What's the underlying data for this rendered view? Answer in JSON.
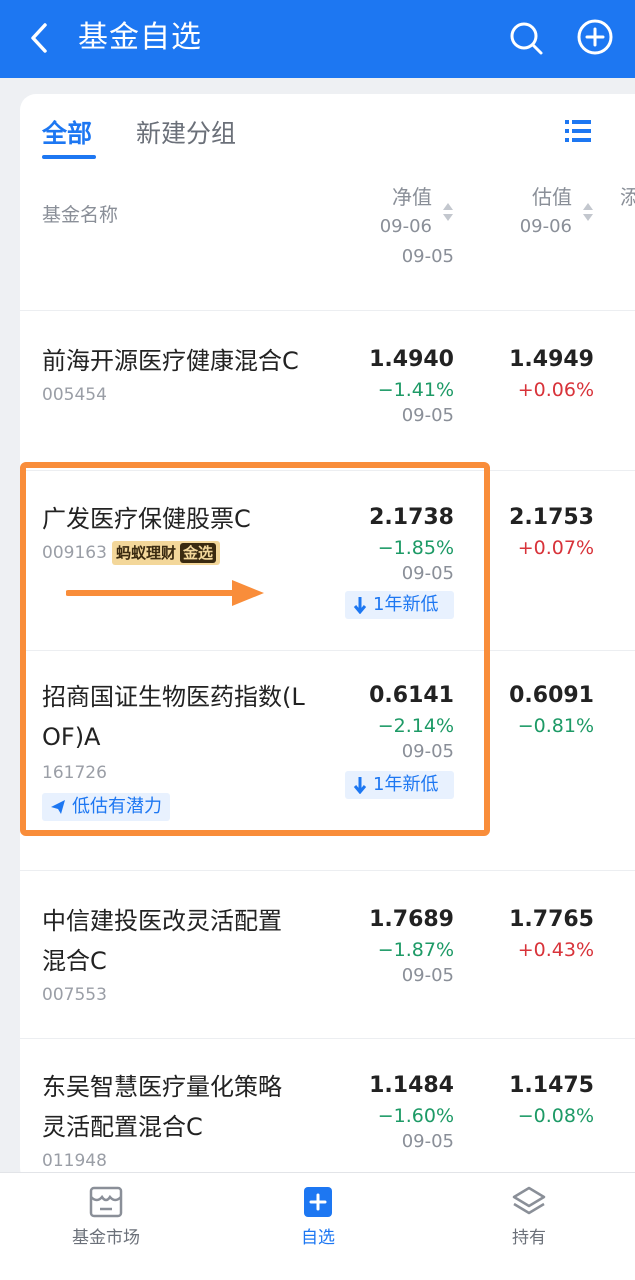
{
  "header": {
    "title": "基金自选"
  },
  "tabs": {
    "all": "全部",
    "new_group": "新建分组"
  },
  "columns": {
    "name": "基金名称",
    "nav": "净值",
    "nav_date": "09-06",
    "est": "估值",
    "est_date": "09-06",
    "cut": "添"
  },
  "partial_row": {
    "date": "09-05"
  },
  "funds": [
    {
      "name": "前海开源医疗健康混合C",
      "code": "005454",
      "nav": "1.4940",
      "nav_pct": "−1.41%",
      "date": "09-05",
      "est": "1.4949",
      "est_pct": "+0.06%"
    },
    {
      "name": "广发医疗保健股票C",
      "code": "009163",
      "nav": "2.1738",
      "nav_pct": "−1.85%",
      "date": "09-05",
      "est": "2.1753",
      "est_pct": "+0.07%",
      "badge_ant": "蚂蚁理财",
      "badge_gold": "金选",
      "tag": "1年新低"
    },
    {
      "name_line1": "招商国证生物医药指数(L",
      "name_line2": "OF)A",
      "code": "161726",
      "nav": "0.6141",
      "nav_pct": "−2.14%",
      "date": "09-05",
      "est": "0.6091",
      "est_pct": "−0.81%",
      "tag": "1年新低",
      "potential": "低估有潜力"
    },
    {
      "name_line1": "中信建投医改灵活配置",
      "name_line2": "混合C",
      "code": "007553",
      "nav": "1.7689",
      "nav_pct": "−1.87%",
      "date": "09-05",
      "est": "1.7765",
      "est_pct": "+0.43%"
    },
    {
      "name_line1": "东吴智慧医疗量化策略",
      "name_line2": "灵活配置混合C",
      "code": "011948",
      "nav": "1.1484",
      "nav_pct": "−1.60%",
      "date": "09-05",
      "est": "1.1475",
      "est_pct": "−0.08%"
    }
  ],
  "bottom_nav": {
    "market": "基金市场",
    "watchlist": "自选",
    "holdings": "持有"
  },
  "colors": {
    "primary": "#1d77f2",
    "up": "#d8333a",
    "down": "#1d9a66",
    "highlight": "#f98d3a"
  }
}
